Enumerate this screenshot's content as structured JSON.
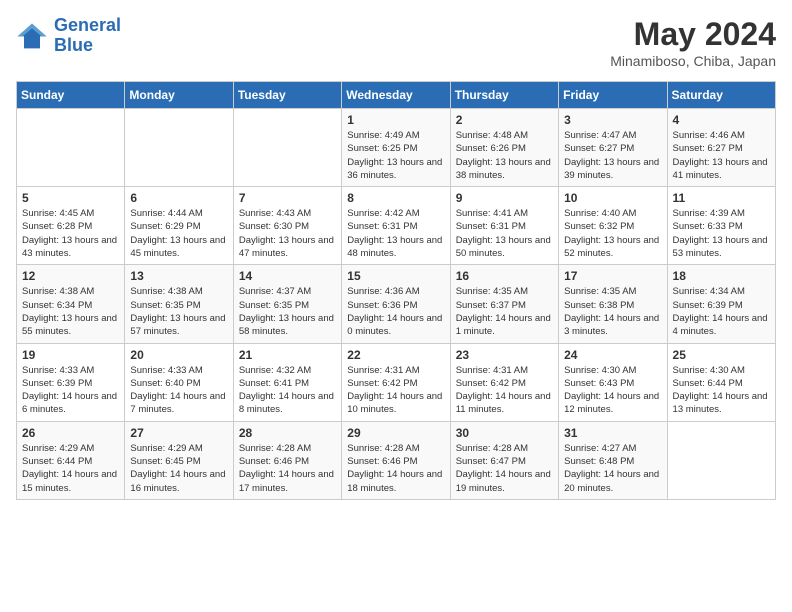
{
  "header": {
    "logo_line1": "General",
    "logo_line2": "Blue",
    "month": "May 2024",
    "location": "Minamiboso, Chiba, Japan"
  },
  "days_of_week": [
    "Sunday",
    "Monday",
    "Tuesday",
    "Wednesday",
    "Thursday",
    "Friday",
    "Saturday"
  ],
  "weeks": [
    [
      {
        "day": "",
        "info": ""
      },
      {
        "day": "",
        "info": ""
      },
      {
        "day": "",
        "info": ""
      },
      {
        "day": "1",
        "info": "Sunrise: 4:49 AM\nSunset: 6:25 PM\nDaylight: 13 hours and 36 minutes."
      },
      {
        "day": "2",
        "info": "Sunrise: 4:48 AM\nSunset: 6:26 PM\nDaylight: 13 hours and 38 minutes."
      },
      {
        "day": "3",
        "info": "Sunrise: 4:47 AM\nSunset: 6:27 PM\nDaylight: 13 hours and 39 minutes."
      },
      {
        "day": "4",
        "info": "Sunrise: 4:46 AM\nSunset: 6:27 PM\nDaylight: 13 hours and 41 minutes."
      }
    ],
    [
      {
        "day": "5",
        "info": "Sunrise: 4:45 AM\nSunset: 6:28 PM\nDaylight: 13 hours and 43 minutes."
      },
      {
        "day": "6",
        "info": "Sunrise: 4:44 AM\nSunset: 6:29 PM\nDaylight: 13 hours and 45 minutes."
      },
      {
        "day": "7",
        "info": "Sunrise: 4:43 AM\nSunset: 6:30 PM\nDaylight: 13 hours and 47 minutes."
      },
      {
        "day": "8",
        "info": "Sunrise: 4:42 AM\nSunset: 6:31 PM\nDaylight: 13 hours and 48 minutes."
      },
      {
        "day": "9",
        "info": "Sunrise: 4:41 AM\nSunset: 6:31 PM\nDaylight: 13 hours and 50 minutes."
      },
      {
        "day": "10",
        "info": "Sunrise: 4:40 AM\nSunset: 6:32 PM\nDaylight: 13 hours and 52 minutes."
      },
      {
        "day": "11",
        "info": "Sunrise: 4:39 AM\nSunset: 6:33 PM\nDaylight: 13 hours and 53 minutes."
      }
    ],
    [
      {
        "day": "12",
        "info": "Sunrise: 4:38 AM\nSunset: 6:34 PM\nDaylight: 13 hours and 55 minutes."
      },
      {
        "day": "13",
        "info": "Sunrise: 4:38 AM\nSunset: 6:35 PM\nDaylight: 13 hours and 57 minutes."
      },
      {
        "day": "14",
        "info": "Sunrise: 4:37 AM\nSunset: 6:35 PM\nDaylight: 13 hours and 58 minutes."
      },
      {
        "day": "15",
        "info": "Sunrise: 4:36 AM\nSunset: 6:36 PM\nDaylight: 14 hours and 0 minutes."
      },
      {
        "day": "16",
        "info": "Sunrise: 4:35 AM\nSunset: 6:37 PM\nDaylight: 14 hours and 1 minute."
      },
      {
        "day": "17",
        "info": "Sunrise: 4:35 AM\nSunset: 6:38 PM\nDaylight: 14 hours and 3 minutes."
      },
      {
        "day": "18",
        "info": "Sunrise: 4:34 AM\nSunset: 6:39 PM\nDaylight: 14 hours and 4 minutes."
      }
    ],
    [
      {
        "day": "19",
        "info": "Sunrise: 4:33 AM\nSunset: 6:39 PM\nDaylight: 14 hours and 6 minutes."
      },
      {
        "day": "20",
        "info": "Sunrise: 4:33 AM\nSunset: 6:40 PM\nDaylight: 14 hours and 7 minutes."
      },
      {
        "day": "21",
        "info": "Sunrise: 4:32 AM\nSunset: 6:41 PM\nDaylight: 14 hours and 8 minutes."
      },
      {
        "day": "22",
        "info": "Sunrise: 4:31 AM\nSunset: 6:42 PM\nDaylight: 14 hours and 10 minutes."
      },
      {
        "day": "23",
        "info": "Sunrise: 4:31 AM\nSunset: 6:42 PM\nDaylight: 14 hours and 11 minutes."
      },
      {
        "day": "24",
        "info": "Sunrise: 4:30 AM\nSunset: 6:43 PM\nDaylight: 14 hours and 12 minutes."
      },
      {
        "day": "25",
        "info": "Sunrise: 4:30 AM\nSunset: 6:44 PM\nDaylight: 14 hours and 13 minutes."
      }
    ],
    [
      {
        "day": "26",
        "info": "Sunrise: 4:29 AM\nSunset: 6:44 PM\nDaylight: 14 hours and 15 minutes."
      },
      {
        "day": "27",
        "info": "Sunrise: 4:29 AM\nSunset: 6:45 PM\nDaylight: 14 hours and 16 minutes."
      },
      {
        "day": "28",
        "info": "Sunrise: 4:28 AM\nSunset: 6:46 PM\nDaylight: 14 hours and 17 minutes."
      },
      {
        "day": "29",
        "info": "Sunrise: 4:28 AM\nSunset: 6:46 PM\nDaylight: 14 hours and 18 minutes."
      },
      {
        "day": "30",
        "info": "Sunrise: 4:28 AM\nSunset: 6:47 PM\nDaylight: 14 hours and 19 minutes."
      },
      {
        "day": "31",
        "info": "Sunrise: 4:27 AM\nSunset: 6:48 PM\nDaylight: 14 hours and 20 minutes."
      },
      {
        "day": "",
        "info": ""
      }
    ]
  ]
}
